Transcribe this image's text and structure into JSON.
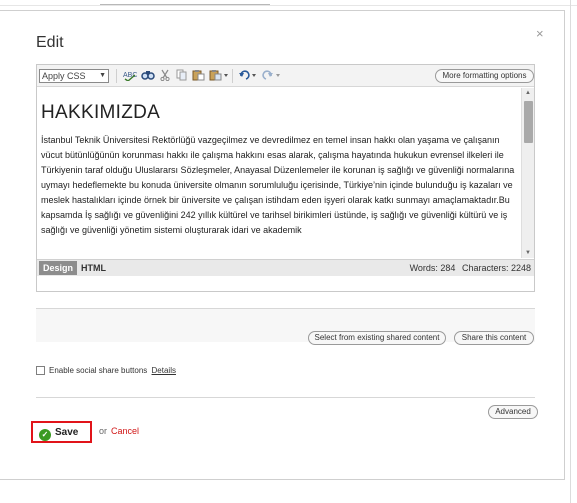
{
  "dialog": {
    "title": "Edit",
    "close_glyph": "×"
  },
  "toolbar": {
    "css_select_value": "Apply CSS",
    "icons": [
      "spellcheck-icon",
      "find-icon",
      "cut-icon",
      "copy-icon",
      "paste-icon",
      "paste-special-icon",
      "undo-icon",
      "redo-icon"
    ],
    "more_formatting_label": "More formatting options"
  },
  "content": {
    "heading": "HAKKIMIZDA",
    "paragraph": "İstanbul Teknik Üniversitesi Rektörlüğü vazgeçilmez ve devredilmez  en temel insan hakkı olan yaşama ve  çalışanın vücut bütünlüğünün korunması hakkı  ile çalışma hakkını  esas alarak,  çalışma hayatında  hukukun evrensel ilkeleri ile Türkiyenin taraf olduğu Uluslararsı Sözleşmeler, Anayasal Düzenlemeler ile korunan iş sağlığı ve güvenliği normalarına uymayı  hedeflemekte  bu konuda üniversite  olmanın sorumluluğu içerisinde, Türkiye’nin içinde bulunduğu  iş kazaları ve meslek hastalıkları içinde  örnek bir üniversite ve çalışan istihdam eden işyeri  olarak katkı sunmayı amaçlamaktadır.Bu kapsamda İş sağlığı ve güvenliğini 242 yıllık kültürel ve tarihsel birikimleri üstünde, iş sağlığı ve güvenliği kültürü ve  iş sağlığı ve güvenliği yönetim sistemi oluşturarak idari ve akademik"
  },
  "modebar": {
    "design_tab": "Design",
    "html_tab": "HTML",
    "words": "Words: 284",
    "characters": "Characters: 2248"
  },
  "shared": {
    "select_label": "Select from existing shared content",
    "share_label": "Share this content"
  },
  "social": {
    "label": "Enable social share buttons",
    "details_link": "Details",
    "checked": false
  },
  "footer": {
    "advanced_label": "Advanced",
    "save_label": "Save",
    "or_text": "or",
    "cancel_label": "Cancel"
  },
  "colors": {
    "accent_red": "#e1141a",
    "save_check_green": "#3a9a22",
    "cancel_red": "#d01616"
  }
}
